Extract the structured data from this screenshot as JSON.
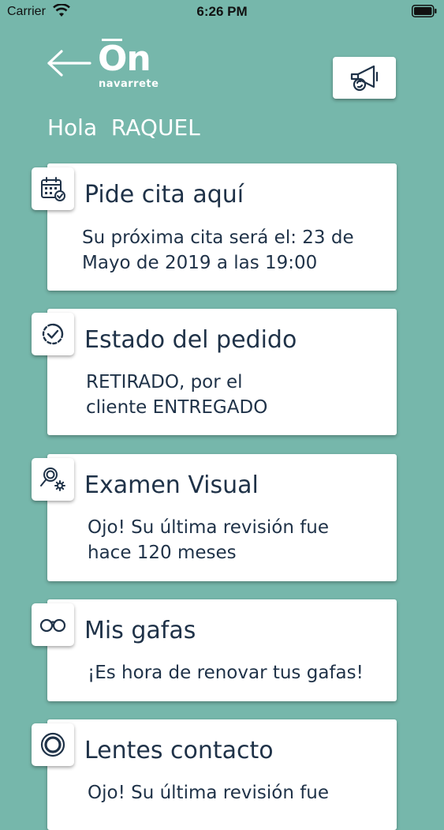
{
  "status_bar": {
    "carrier": "Carrier",
    "time": "6:26 PM"
  },
  "header": {
    "logo_mark": "On",
    "logo_subtitle": "navarrete",
    "greeting": "Hola  RAQUEL"
  },
  "cards": [
    {
      "title": "Pide cita aquí",
      "body": "Su próxima cita será el: 23 de\nMayo de 2019 a las 19:00",
      "icon": "calendar-icon"
    },
    {
      "title": "Estado del pedido",
      "body": "RETIRADO, por el\ncliente ENTREGADO",
      "icon": "check-circle-icon"
    },
    {
      "title": "Examen Visual",
      "body": "Ojo! Su última revisión fue\nhace 120 meses",
      "icon": "magnifier-gear-icon"
    },
    {
      "title": "Mis gafas",
      "body": "¡Es hora de renovar tus gafas!",
      "icon": "glasses-icon"
    },
    {
      "title": "Lentes contacto",
      "body": "Ojo! Su última revisión fue",
      "icon": "contact-lens-icon"
    }
  ],
  "colors": {
    "background": "#76b7ab",
    "text": "#1f3248",
    "card": "#ffffff"
  }
}
